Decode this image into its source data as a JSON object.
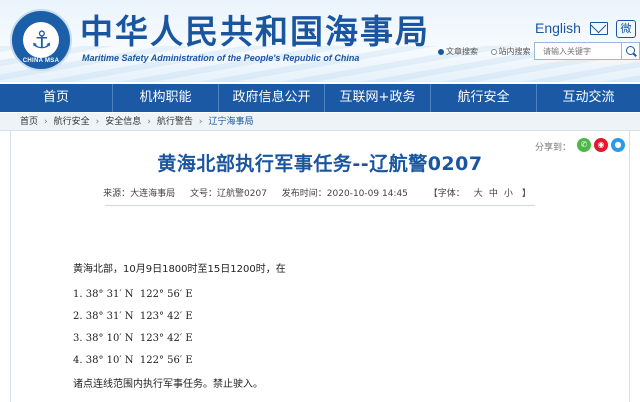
{
  "header": {
    "logo_text": "CHINA MSA",
    "title": "中华人民共和国海事局",
    "subtitle": "Maritime Safety Administration of the People's Republic of China",
    "english_link": "English",
    "mail_icon": "mail-icon",
    "weibo_icon": "weibo-icon",
    "search": {
      "options": [
        "文章搜索",
        "站内搜索"
      ],
      "selected_option": "文章搜索",
      "placeholder": "请输入关键字"
    }
  },
  "nav": {
    "items": [
      "首页",
      "机构职能",
      "政府信息公开",
      "互联网+政务",
      "航行安全",
      "互动交流"
    ],
    "active": "航行安全",
    "color": "#1b59a5"
  },
  "breadcrumb": [
    "首页",
    "航行安全",
    "安全信息",
    "航行警告",
    "辽宁海事局"
  ],
  "share": {
    "label": "分享到：",
    "icons": [
      "wechat-icon",
      "weibo-icon",
      "qq-icon"
    ]
  },
  "article": {
    "title": "黄海北部执行军事任务--辽航警0207",
    "meta": {
      "source": "来源：大连海事局",
      "doc_no": "文号：辽航警0207",
      "date": "发布时间：2020-10-09 14:45",
      "font_label": "【字体：",
      "font_sizes": [
        "大",
        "中",
        "小"
      ],
      "font_close": "】"
    },
    "intro": "黄海北部，10月9日1800时至15日1200时，在",
    "points": [
      "1. 38° 31′ N  122° 56′ E",
      "2. 38° 31′ N  123° 42′ E",
      "3. 38° 10′ N  123° 42′ E",
      "4. 38° 10′ N  122° 56′ E"
    ],
    "closing": "诸点连线范围内执行军事任务。禁止驶入。"
  },
  "colors": {
    "brand_blue": "#1a56a0",
    "nav_blue": "#1b59a5",
    "breadcrumb_bg": "#eef3f8"
  }
}
